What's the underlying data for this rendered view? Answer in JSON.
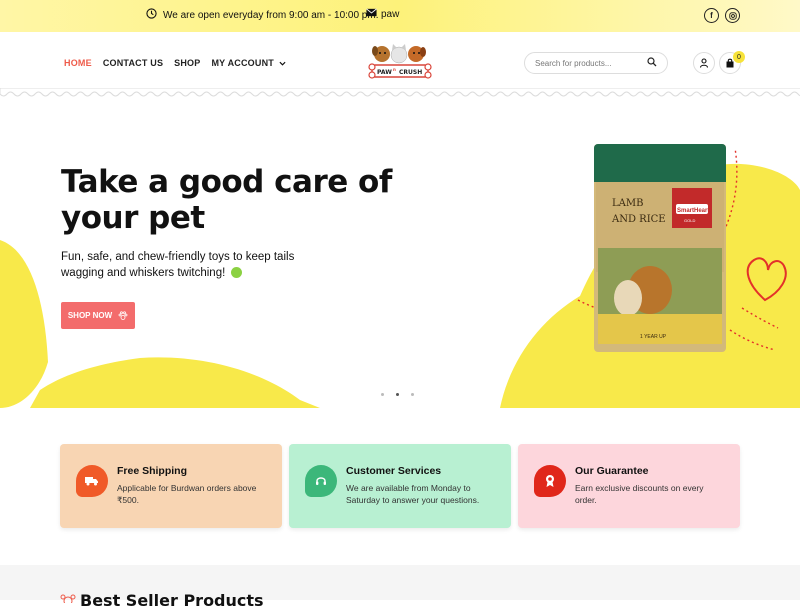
{
  "topbar": {
    "hours": "We are open everyday from 9:00 am - 10:00 pm.",
    "email": "paw",
    "social": [
      "facebook-icon",
      "instagram-icon"
    ]
  },
  "nav": {
    "items": [
      "HOME",
      "CONTACT US",
      "SHOP",
      "MY ACCOUNT"
    ],
    "active": "HOME"
  },
  "logo": {
    "text_top": "PAW",
    "text_mid": "n",
    "text_bottom": "CRUSH"
  },
  "search": {
    "placeholder": "Search for products..."
  },
  "cart": {
    "count": "0"
  },
  "hero": {
    "title": "Take a good care of your pet",
    "subtitle": "Fun, safe, and chew-friendly toys to keep tails wagging and whiskers twitching!",
    "button": "SHOP NOW",
    "slides": 3,
    "active_slide": 2,
    "product": {
      "brand": "SmartHeart",
      "sub_brand": "GOLD",
      "line1": "LAMB",
      "line2": "AND RICE",
      "age": "1 YEAR UP"
    }
  },
  "features": [
    {
      "title": "Free Shipping",
      "desc": "Applicable for Burdwan orders above ₹500.",
      "color": "#f8d5b3",
      "icon_color": "#f05a28",
      "icon": "truck-icon"
    },
    {
      "title": "Customer Services",
      "desc": "We are available from Monday to Saturday to answer your questions.",
      "color": "#b8f0d2",
      "icon_color": "#3cb77a",
      "icon": "headset-icon"
    },
    {
      "title": "Our Guarantee",
      "desc": "Earn exclusive discounts on every order.",
      "color": "#fdd6dc",
      "icon_color": "#e0271a",
      "icon": "award-icon"
    }
  ],
  "section": {
    "title": "Best Seller Products"
  },
  "colors": {
    "accent": "#ee5b4a",
    "yellow": "#f8e94a",
    "button": "#f36c6c"
  }
}
